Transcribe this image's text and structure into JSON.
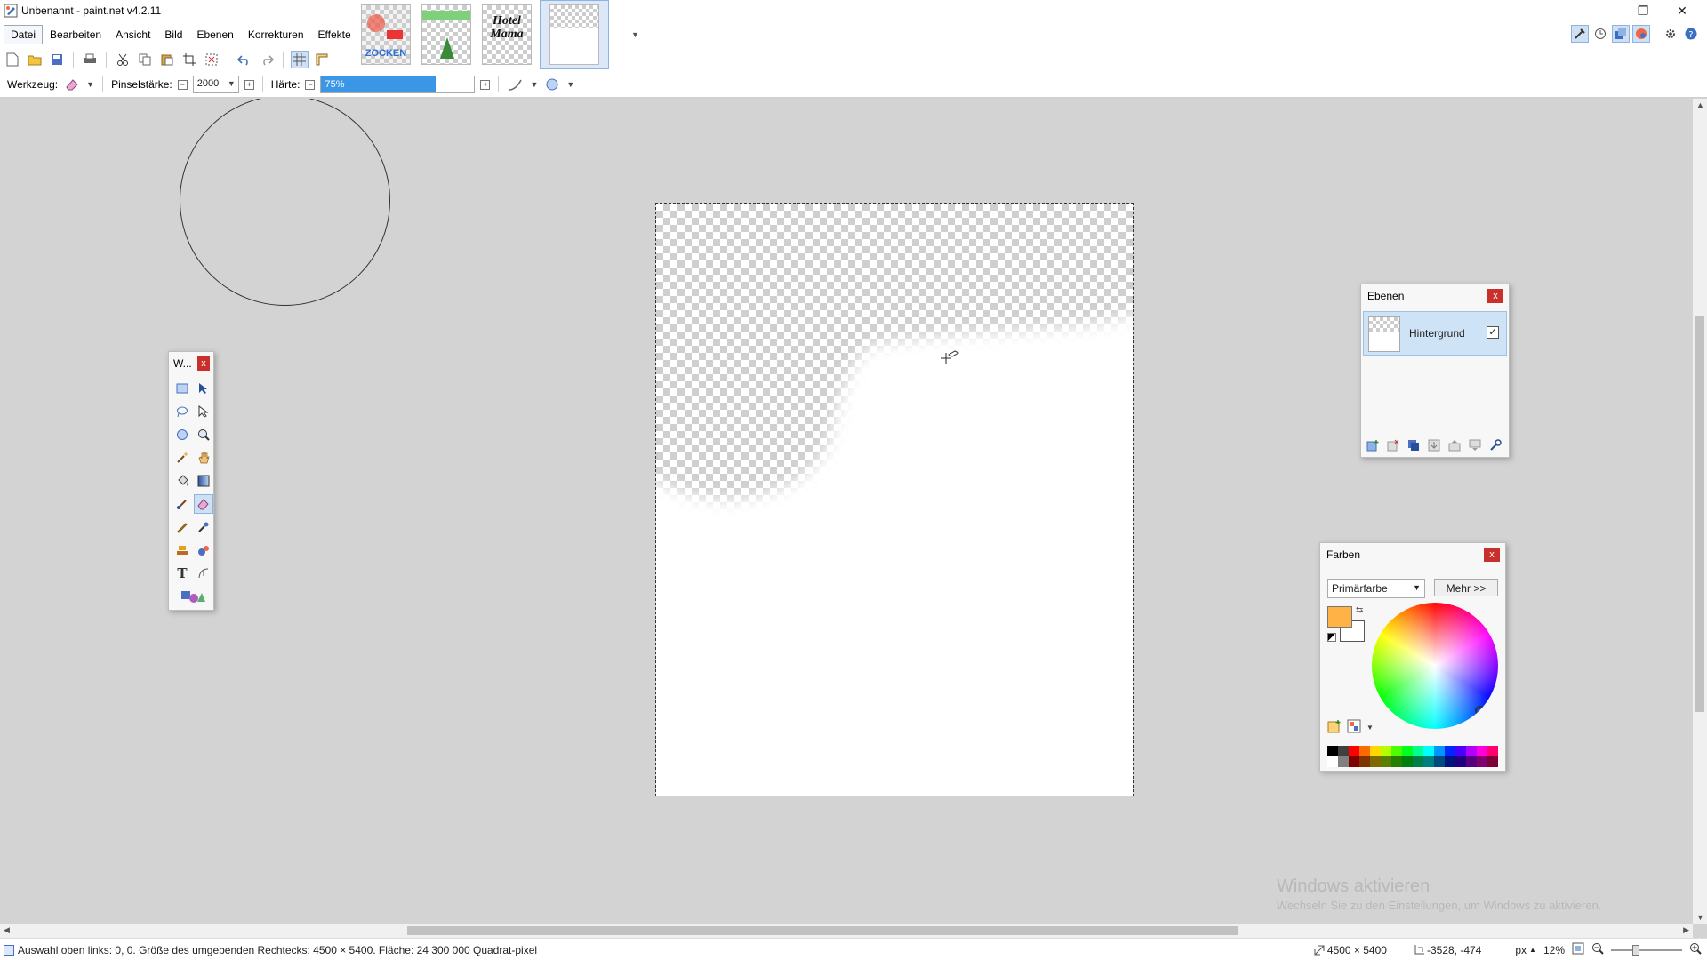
{
  "window": {
    "title": "Unbenannt - paint.net v4.2.11",
    "minimize": "–",
    "restore": "❐",
    "close": "✕"
  },
  "menu": {
    "items": [
      "Datei",
      "Bearbeiten",
      "Ansicht",
      "Bild",
      "Ebenen",
      "Korrekturen",
      "Effekte"
    ]
  },
  "thumbnails": [
    {
      "label": "ZOCKEN"
    },
    {
      "label": ""
    },
    {
      "label": "Hotel Mama"
    },
    {
      "label": ""
    }
  ],
  "toolbar": {
    "tool_label": "Werkzeug:",
    "brush_size_label": "Pinselstärke:",
    "brush_size_value": "2000",
    "hardness_label": "Härte:",
    "hardness_value": "75%",
    "hardness_fraction": 0.75
  },
  "tools_window": {
    "title": "W...",
    "close": "x"
  },
  "layers_window": {
    "title": "Ebenen",
    "close": "x",
    "layer_name": "Hintergrund",
    "layer_visible": "✓"
  },
  "colors_window": {
    "title": "Farben",
    "close": "x",
    "selector_value": "Primärfarbe",
    "more_button": "Mehr >>",
    "primary_color": "#ffb347",
    "secondary_color": "#ffffff"
  },
  "watermark": {
    "line1": "Windows aktivieren",
    "line2": "Wechseln Sie zu den Einstellungen, um Windows zu aktivieren."
  },
  "status": {
    "selection_info": "Auswahl oben links: 0, 0. Größe des umgebenden Rechtecks: 4500 × 5400. Fläche: 24 300 000 Quadrat-pixel",
    "image_size": "4500 × 5400",
    "cursor_pos": "-3528, -474",
    "unit": "px",
    "zoom": "12%"
  },
  "icons": {
    "app": "paintnet-icon",
    "colors": {
      "accent": "#3c96e6",
      "close_red": "#c9302c",
      "selection_blue": "#cfe0f5"
    }
  }
}
